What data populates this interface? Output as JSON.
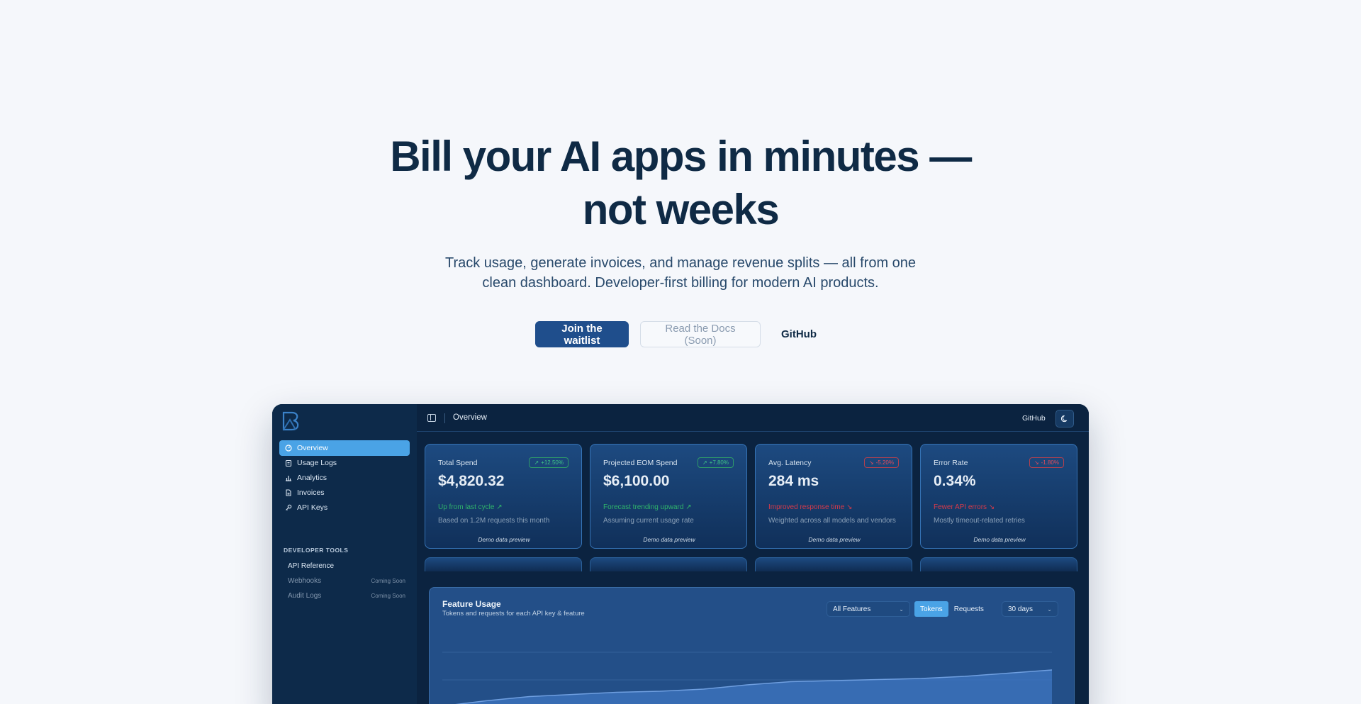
{
  "hero": {
    "title_line1": "Bill your AI apps in minutes —",
    "title_line2": "not weeks",
    "subtitle_line1": "Track usage, generate invoices, and manage revenue splits — all from one",
    "subtitle_line2": "clean dashboard. Developer-first billing for modern AI products.",
    "cta_primary": "Join the waitlist",
    "cta_docs": "Read the Docs (Soon)",
    "cta_github": "GitHub"
  },
  "colors": {
    "accent": "#4aa3e6",
    "primary_button": "#1f4e8c",
    "positive": "#2fb36b",
    "negative": "#d63a4a",
    "dashboard_bg": "#0c2440"
  },
  "sidebar": {
    "nav": [
      {
        "label": "Overview",
        "icon": "gauge-icon",
        "active": true
      },
      {
        "label": "Usage Logs",
        "icon": "clipboard-icon",
        "active": false
      },
      {
        "label": "Analytics",
        "icon": "bar-chart-icon",
        "active": false
      },
      {
        "label": "Invoices",
        "icon": "file-text-icon",
        "active": false
      },
      {
        "label": "API Keys",
        "icon": "key-icon",
        "active": false
      }
    ],
    "section_label": "DEVELOPER TOOLS",
    "tools": [
      {
        "label": "API Reference",
        "badge": ""
      },
      {
        "label": "Webhooks",
        "badge": "Coming Soon"
      },
      {
        "label": "Audit Logs",
        "badge": "Coming Soon"
      }
    ]
  },
  "topbar": {
    "title": "Overview",
    "github": "GitHub",
    "theme_icon": "moon-icon"
  },
  "cards": [
    {
      "label": "Total Spend",
      "badge": "+12.50%",
      "direction": "up",
      "value": "$4,820.32",
      "trend": "Up from last cycle",
      "note": "Based on 1.2M requests this month",
      "demo": "Demo data preview"
    },
    {
      "label": "Projected EOM Spend",
      "badge": "+7.80%",
      "direction": "up",
      "value": "$6,100.00",
      "trend": "Forecast trending upward",
      "note": "Assuming current usage rate",
      "demo": "Demo data preview"
    },
    {
      "label": "Avg. Latency",
      "badge": "-5.20%",
      "direction": "down",
      "value": "284 ms",
      "trend": "Improved response time",
      "note": "Weighted across all models and vendors",
      "demo": "Demo data preview"
    },
    {
      "label": "Error Rate",
      "badge": "-1.80%",
      "direction": "down",
      "value": "0.34%",
      "trend": "Fewer API errors",
      "note": "Mostly timeout-related retries",
      "demo": "Demo data preview"
    }
  ],
  "feature_usage": {
    "title": "Feature Usage",
    "subtitle": "Tokens and requests for each API key & feature",
    "filter": "All Features",
    "toggle": [
      "Tokens",
      "Requests"
    ],
    "toggle_active": "Tokens",
    "range": "30 days"
  },
  "chart_data": {
    "type": "area",
    "title": "Feature Usage",
    "series": [
      {
        "values": [
          0.42,
          0.47,
          0.51,
          0.53,
          0.55,
          0.56,
          0.58,
          0.62,
          0.65,
          0.66,
          0.67,
          0.68,
          0.7,
          0.73,
          0.76
        ]
      }
    ],
    "ylim": [
      0,
      1
    ],
    "grid": true,
    "legend": "none"
  }
}
